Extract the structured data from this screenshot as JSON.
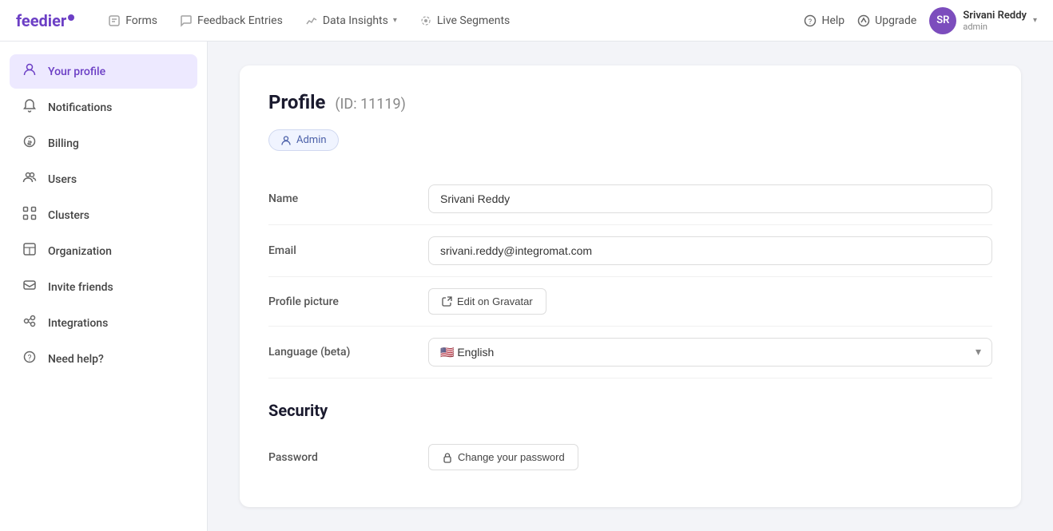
{
  "app": {
    "logo": "feedier",
    "logo_dot": "●"
  },
  "nav": {
    "links": [
      {
        "id": "forms",
        "label": "Forms",
        "icon": "forms-icon"
      },
      {
        "id": "feedback-entries",
        "label": "Feedback Entries",
        "icon": "feedback-icon"
      },
      {
        "id": "data-insights",
        "label": "Data Insights",
        "icon": "insights-icon",
        "has_dropdown": true
      },
      {
        "id": "live-segments",
        "label": "Live Segments",
        "icon": "live-icon"
      }
    ],
    "right": [
      {
        "id": "help",
        "label": "Help",
        "icon": "help-icon"
      },
      {
        "id": "upgrade",
        "label": "Upgrade",
        "icon": "upgrade-icon"
      }
    ],
    "user": {
      "name": "Srivani Reddy",
      "role": "admin",
      "initials": "SR",
      "avatar_color": "#7c4dbd"
    }
  },
  "sidebar": {
    "items": [
      {
        "id": "your-profile",
        "label": "Your profile",
        "icon": "person-icon",
        "active": true
      },
      {
        "id": "notifications",
        "label": "Notifications",
        "icon": "bell-icon",
        "active": false
      },
      {
        "id": "billing",
        "label": "Billing",
        "icon": "billing-icon",
        "active": false
      },
      {
        "id": "users",
        "label": "Users",
        "icon": "users-icon",
        "active": false
      },
      {
        "id": "clusters",
        "label": "Clusters",
        "icon": "clusters-icon",
        "active": false
      },
      {
        "id": "organization",
        "label": "Organization",
        "icon": "org-icon",
        "active": false
      },
      {
        "id": "invite-friends",
        "label": "Invite friends",
        "icon": "invite-icon",
        "active": false
      },
      {
        "id": "integrations",
        "label": "Integrations",
        "icon": "integrations-icon",
        "active": false
      },
      {
        "id": "need-help",
        "label": "Need help?",
        "icon": "help-circle-icon",
        "active": false
      }
    ]
  },
  "profile": {
    "title": "Profile",
    "id_text": "(ID: 11119)",
    "admin_badge": "Admin",
    "fields": {
      "name_label": "Name",
      "name_value": "Srivani Reddy",
      "email_label": "Email",
      "email_value": "srivani.reddy@integromat.com",
      "profile_picture_label": "Profile picture",
      "edit_gravatar_label": "Edit on Gravatar",
      "language_label": "Language (beta)",
      "language_value": "English",
      "language_flag": "🇺🇸"
    },
    "security": {
      "title": "Security",
      "password_label": "Password",
      "change_password_label": "Change your password"
    }
  }
}
